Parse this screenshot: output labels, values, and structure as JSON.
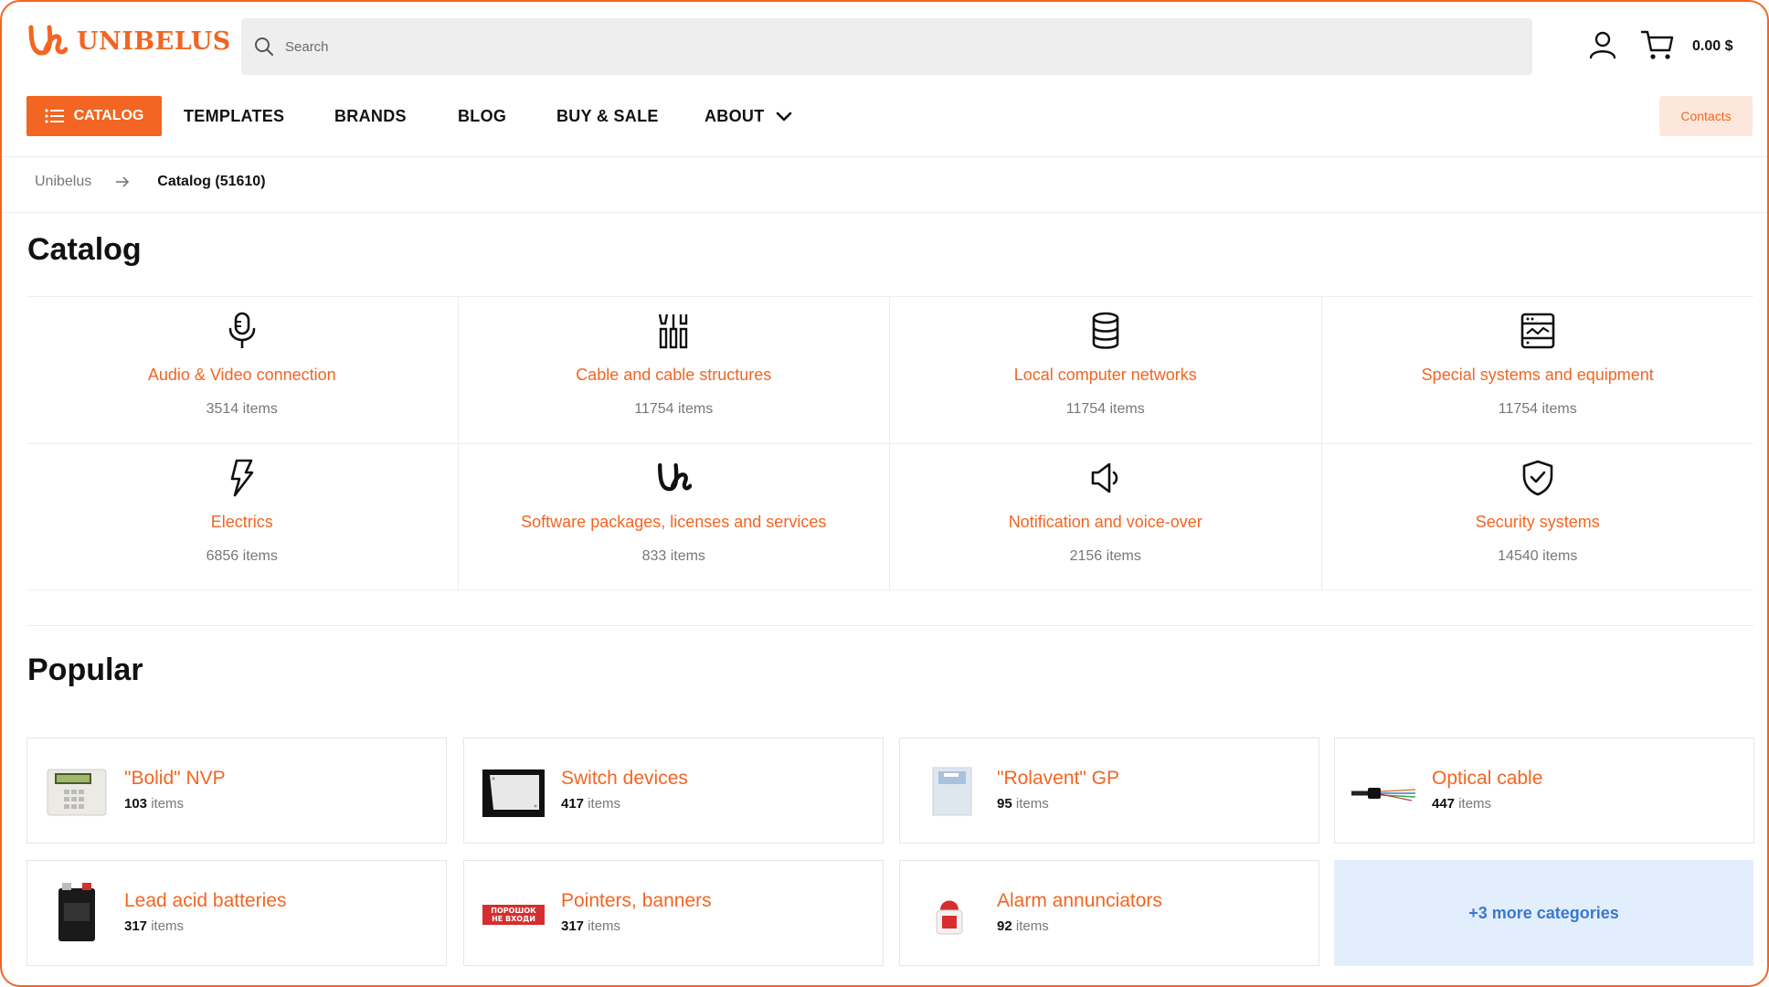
{
  "brand": {
    "name": "UNIBELUS",
    "accent": "#f26522"
  },
  "search": {
    "placeholder": "Search"
  },
  "header": {
    "cart_total": "0.00 $"
  },
  "nav": {
    "catalog_label": "CATALOG",
    "links": [
      "TEMPLATES",
      "BRANDS",
      "BLOG",
      "BUY & SALE",
      "ABOUT"
    ],
    "contacts_label": "Contacts"
  },
  "breadcrumb": {
    "home": "Unibelus",
    "current": "Catalog (51610)"
  },
  "catalog": {
    "title": "Catalog",
    "categories": [
      {
        "name": "Audio & Video connection",
        "count": "3514 items",
        "icon": "microphone-icon"
      },
      {
        "name": "Cable and cable structures",
        "count": "11754 items",
        "icon": "tools-icon"
      },
      {
        "name": "Local computer networks",
        "count": "11754 items",
        "icon": "database-icon"
      },
      {
        "name": "Special systems and equipment",
        "count": "11754 items",
        "icon": "server-panel-icon"
      },
      {
        "name": "Electrics",
        "count": "6856 items",
        "icon": "lightning-icon"
      },
      {
        "name": "Software packages, licenses and services",
        "count": "833 items",
        "icon": "unibelus-logo-icon"
      },
      {
        "name": "Notification and voice-over",
        "count": "2156 items",
        "icon": "speaker-icon"
      },
      {
        "name": "Security systems",
        "count": "14540 items",
        "icon": "shield-check-icon"
      }
    ]
  },
  "popular": {
    "title": "Popular",
    "items_word": "items",
    "items": [
      {
        "name": "\"Bolid\" NVP",
        "count": "103"
      },
      {
        "name": "Switch devices",
        "count": "417"
      },
      {
        "name": "\"Rolavent\" GP",
        "count": "95"
      },
      {
        "name": "Optical cable",
        "count": "447"
      },
      {
        "name": "Lead acid batteries",
        "count": "317"
      },
      {
        "name": "Pointers, banners",
        "count": "317"
      },
      {
        "name": "Alarm annunciators",
        "count": "92"
      }
    ],
    "more_label": "+3 more categories",
    "banner_text_1": "ПОРОШОК",
    "banner_text_2": "НЕ ВХОДИ"
  }
}
